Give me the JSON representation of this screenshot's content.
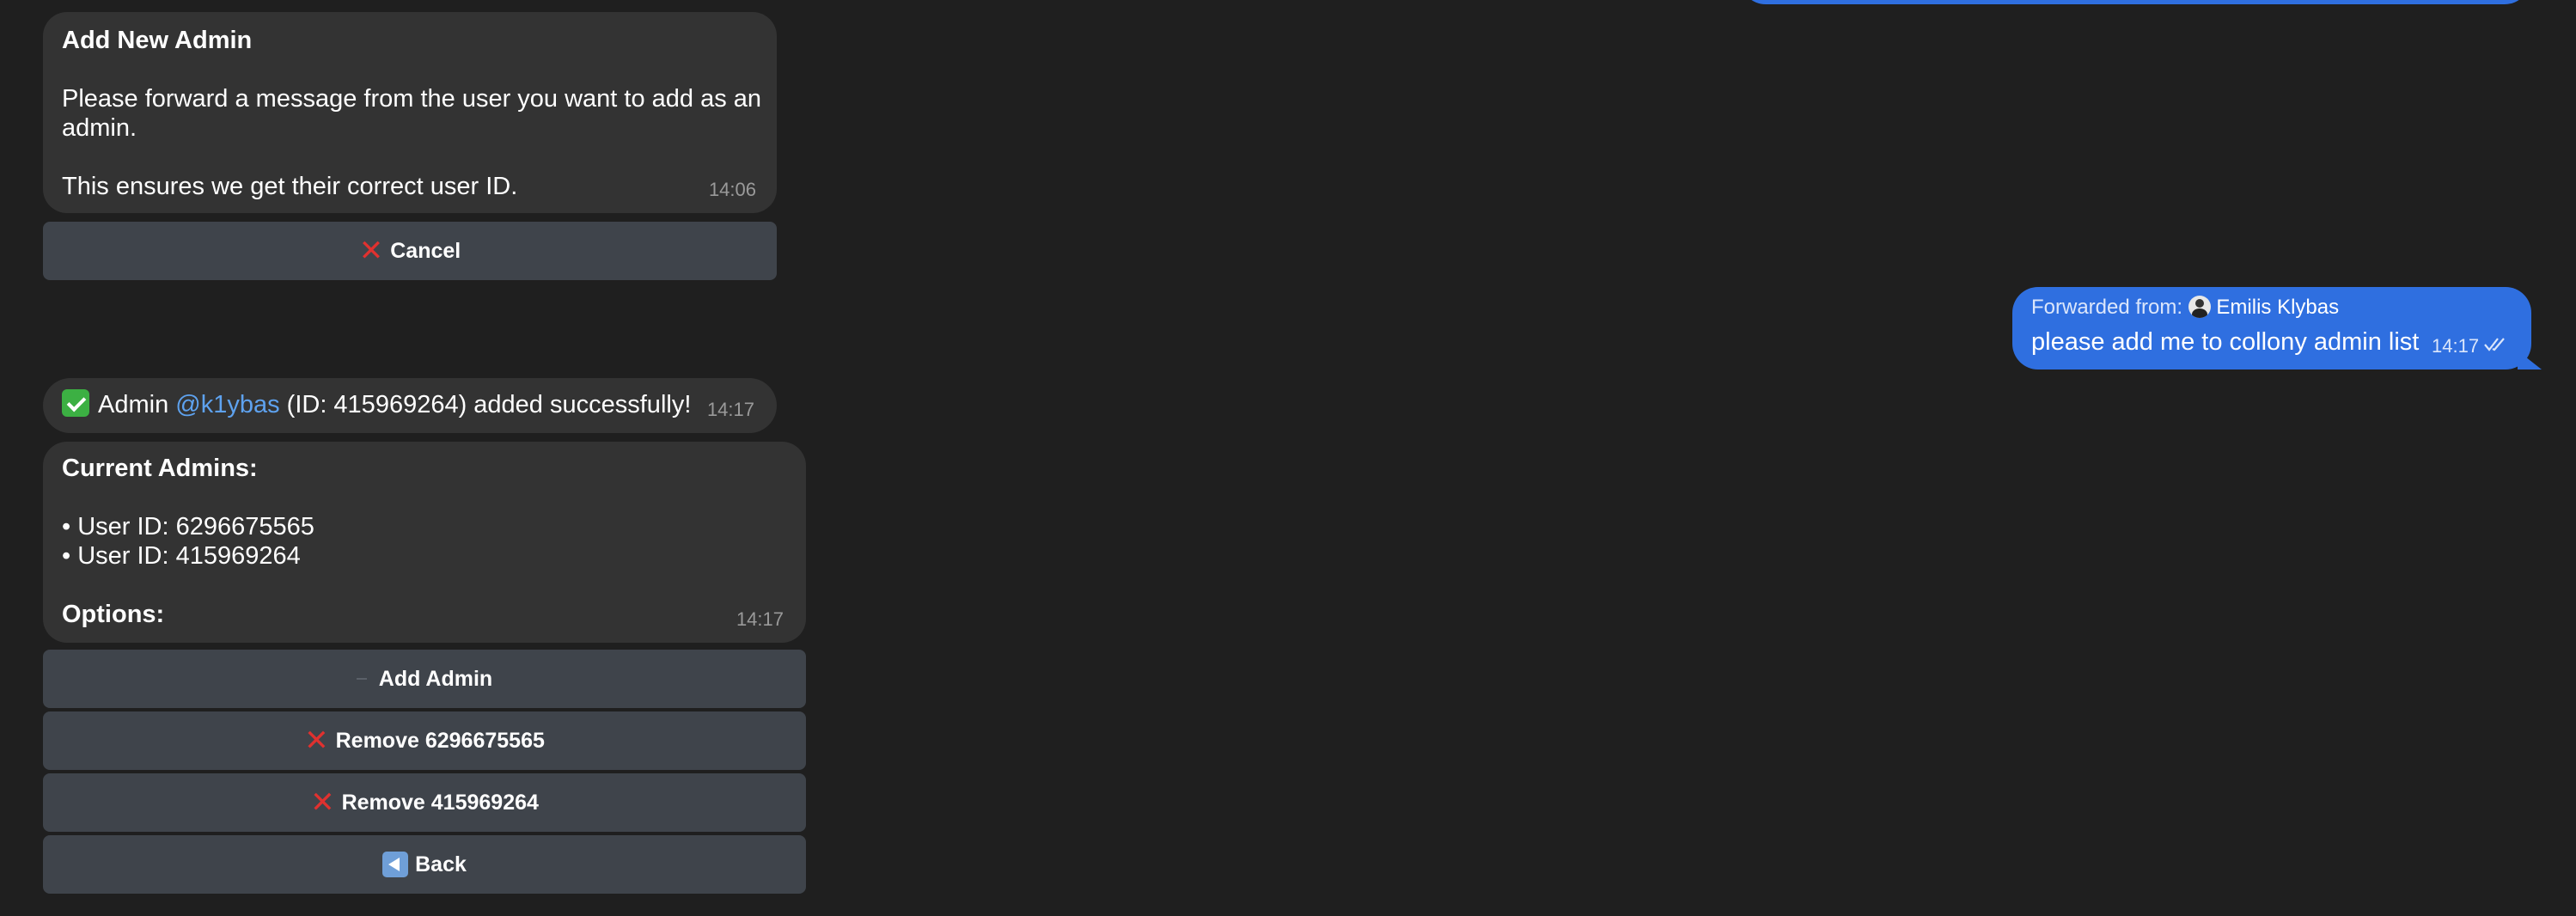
{
  "add_admin_prompt": {
    "title": "Add New Admin",
    "line1": "Please forward a message from the user you want to add as an",
    "line2": "admin.",
    "line3": "This ensures we get their correct user ID.",
    "time": "14:06",
    "cancel_label": "Cancel"
  },
  "forwarded": {
    "prefix": "Forwarded from:",
    "sender": "Emilis Klybas",
    "text": "please add me to collony admin list",
    "time": "14:17"
  },
  "success": {
    "prefix": "Admin",
    "mention": "@k1ybas",
    "suffix": "(ID: 415969264) added successfully!",
    "time": "14:17"
  },
  "admins": {
    "title": "Current Admins:",
    "items": [
      "• User ID: 6296675565",
      "• User ID: 415969264"
    ],
    "options_label": "Options:",
    "time": "14:17",
    "buttons": {
      "add": "Add Admin",
      "remove1": "Remove 6296675565",
      "remove2": "Remove 415969264",
      "back": "Back"
    }
  },
  "colors": {
    "background": "#1f1f1f",
    "incoming_bubble": "#333333",
    "outgoing_bubble": "#2f6fe0",
    "keyboard_button": "#3f444b",
    "mention": "#5ea2ef"
  }
}
